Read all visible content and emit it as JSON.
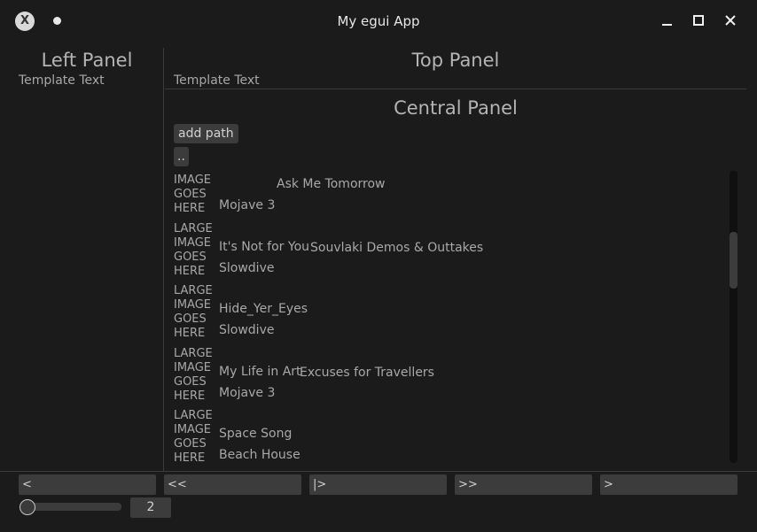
{
  "window": {
    "title": "My egui App",
    "icons": {
      "app": "egui-logo-icon",
      "pin": "sticky-dot-icon",
      "minimize": "minimize-icon",
      "maximize": "maximize-icon",
      "close": "close-icon"
    }
  },
  "left_panel": {
    "heading": "Left Panel",
    "text": "Template Text"
  },
  "top_panel": {
    "heading": "Top Panel",
    "text": "Template Text"
  },
  "central_panel": {
    "heading": "Central Panel",
    "add_path_label": "add path",
    "up_dir_label": ".."
  },
  "tracks": [
    {
      "image": "LARGE IMAGE GOES HERE",
      "title": "",
      "album": "Ask Me Tomorrow",
      "artist": "Mojave 3"
    },
    {
      "image": "LARGE IMAGE GOES HERE",
      "title": "It's Not for You",
      "album": "Souvlaki Demos & Outtakes",
      "artist": "Slowdive"
    },
    {
      "image": "LARGE IMAGE GOES HERE",
      "title": "Hide_Yer_Eyes",
      "album": "",
      "artist": "Slowdive"
    },
    {
      "image": "LARGE IMAGE GOES HERE",
      "title": "My Life in Art",
      "album": "Excuses for Travellers",
      "artist": "Mojave 3"
    },
    {
      "image": "LARGE IMAGE GOES HERE",
      "title": "Space Song",
      "album": "",
      "artist": "Beach House"
    }
  ],
  "controls": {
    "prev_label": "<",
    "seek_back_label": "<<",
    "play_label": "|>",
    "seek_forward_label": ">>",
    "next_label": ">",
    "volume_value": "2"
  }
}
